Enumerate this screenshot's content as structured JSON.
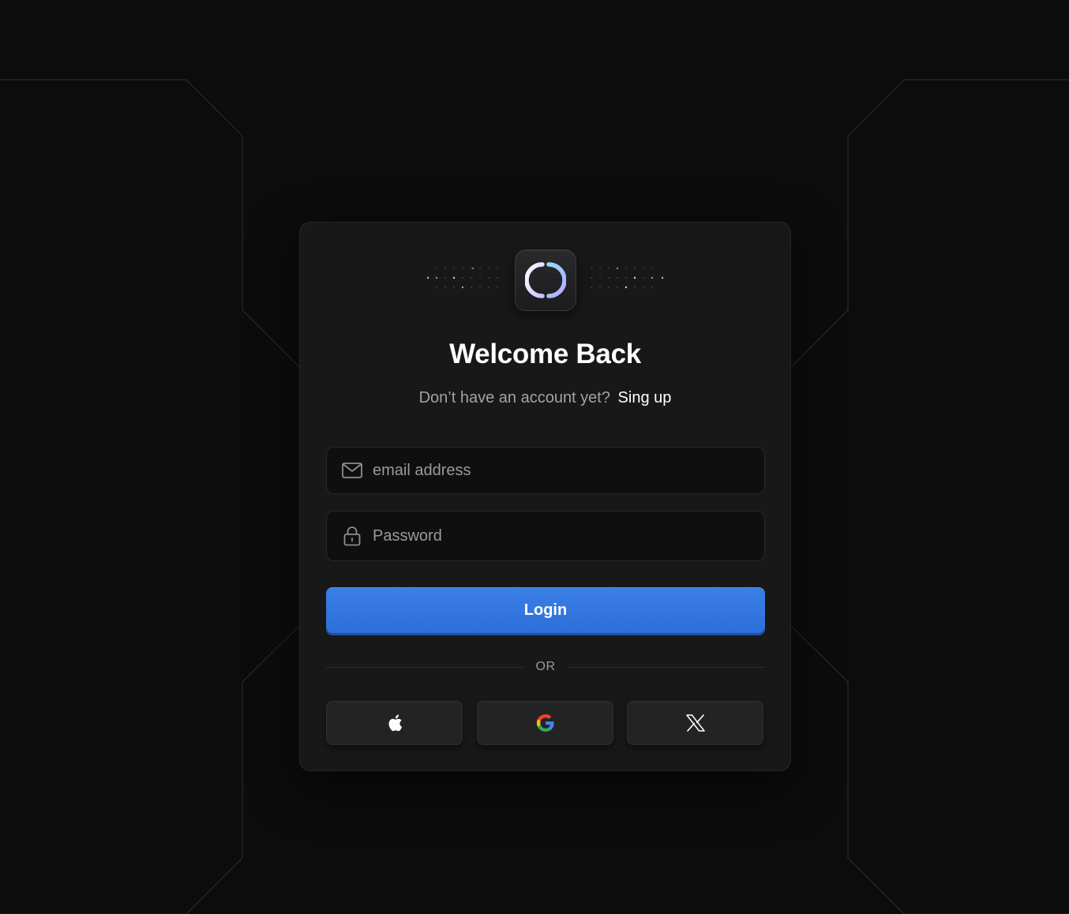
{
  "auth": {
    "title": "Welcome Back",
    "subtitle_prompt": "Don’t have an account yet?",
    "signup_link": "Sing up"
  },
  "form": {
    "email": {
      "placeholder": "email address",
      "value": "",
      "icon": "mail-icon"
    },
    "password": {
      "placeholder": "Password",
      "value": "",
      "icon": "lock-icon"
    },
    "login_label": "Login",
    "divider_label": "OR"
  },
  "social": [
    {
      "name": "apple",
      "icon": "apple-icon"
    },
    {
      "name": "google",
      "icon": "google-icon"
    },
    {
      "name": "x",
      "icon": "x-icon"
    }
  ],
  "colors": {
    "background": "#0c0c0c",
    "card": "#181818",
    "accent": "#3a7fe6",
    "text_primary": "#ffffff",
    "text_muted": "#a3a3a3"
  }
}
